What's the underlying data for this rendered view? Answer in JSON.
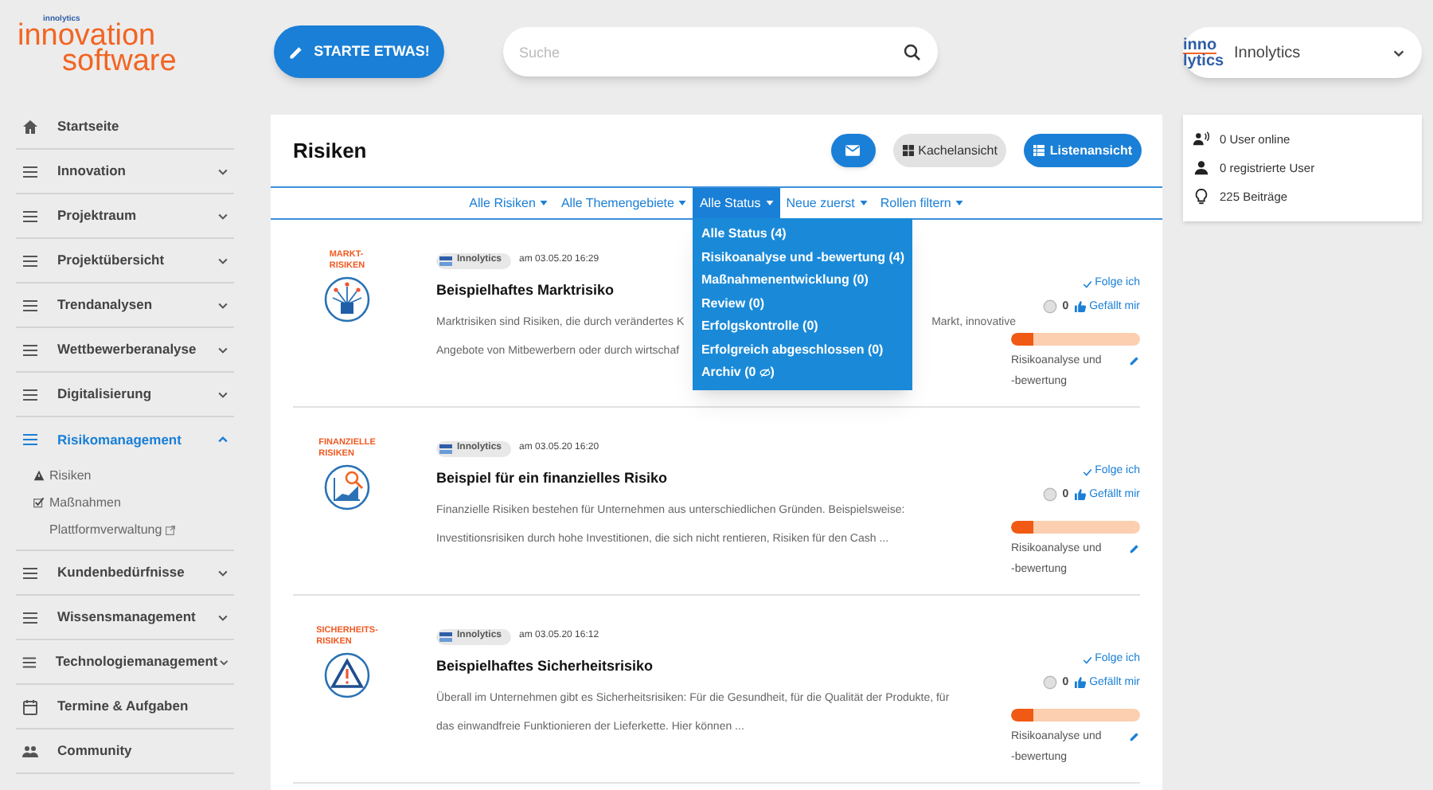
{
  "logo": {
    "brand": "innolytics",
    "line1": "innovation",
    "line2": "software"
  },
  "start_button": {
    "label": "STARTE ETWAS!"
  },
  "search": {
    "placeholder": "Suche"
  },
  "org_selector": {
    "logo_lines": [
      "inno",
      "lytics"
    ],
    "label": "Innolytics"
  },
  "sidebar": {
    "items": [
      {
        "label": "Startseite",
        "kind": "home",
        "selected": false
      },
      {
        "label": "Innovation",
        "kind": "menu",
        "selected": false,
        "expanded": false
      },
      {
        "label": "Projektraum",
        "kind": "menu",
        "selected": false,
        "expanded": false
      },
      {
        "label": "Projektübersicht",
        "kind": "menu",
        "selected": false,
        "expanded": false
      },
      {
        "label": "Trendanalysen",
        "kind": "menu",
        "selected": false,
        "expanded": false
      },
      {
        "label": "Wettbewerberanalyse",
        "kind": "menu",
        "selected": false,
        "expanded": false
      },
      {
        "label": "Digitalisierung",
        "kind": "menu",
        "selected": false,
        "expanded": false
      },
      {
        "label": "Risikomanagement",
        "kind": "menu",
        "selected": true,
        "expanded": true,
        "children": [
          {
            "label": "Risiken",
            "kind": "warning"
          },
          {
            "label": "Maßnahmen",
            "kind": "check"
          },
          {
            "label": "Plattformverwaltung",
            "kind": "external"
          }
        ]
      },
      {
        "label": "Kundenbedürfnisse",
        "kind": "menu",
        "selected": false,
        "expanded": false
      },
      {
        "label": "Wissensmanagement",
        "kind": "menu",
        "selected": false,
        "expanded": false
      },
      {
        "label": "Technologiemanagement",
        "kind": "menu",
        "selected": false,
        "expanded": false
      },
      {
        "label": "Termine & Aufgaben",
        "kind": "calendar",
        "selected": false
      },
      {
        "label": "Community",
        "kind": "community",
        "selected": false
      }
    ]
  },
  "main": {
    "title": "Risiken",
    "view_buttons": [
      {
        "kind": "mail",
        "selected": false
      },
      {
        "kind": "tiles",
        "label": "Kachelansicht",
        "selected": false
      },
      {
        "kind": "list",
        "label": "Listenansicht",
        "selected": true
      }
    ],
    "filters": [
      {
        "label": "Alle Risiken",
        "selected": false
      },
      {
        "label": "Alle Themengebiete",
        "selected": false
      },
      {
        "label": "Alle Status",
        "selected": true,
        "expanded": true,
        "options": [
          {
            "label": "Alle Status (4)"
          },
          {
            "label": "Risikoanalyse und -bewertung (4)"
          },
          {
            "label": "Maßnahmenentwicklung (0)"
          },
          {
            "label": "Review (0)"
          },
          {
            "label": "Erfolgskontrolle (0)"
          },
          {
            "label": "Erfolgreich abgeschlossen (0)"
          },
          {
            "label": "Archiv (0",
            "suffix": ")",
            "kind": "hidden"
          }
        ]
      },
      {
        "label": "Neue zuerst",
        "selected": false
      },
      {
        "label": "Rollen filtern",
        "selected": false
      }
    ],
    "posts": [
      {
        "label": [
          "MARKT-",
          "RISIKEN"
        ],
        "kind": "market",
        "author": "Innolytics",
        "date": "am 03.05.20 16:29",
        "title": "Beispielhaftes Marktrisiko",
        "excerpt": [
          [
            "Marktrisiken sind Risiken, die durch verändertes K",
            "Markt, innovative"
          ],
          [
            "Angebote von Mitbewerbern oder durch wirtschaf"
          ]
        ],
        "follow": "Folge ich",
        "likes": "0",
        "like": "Gefällt mir",
        "level": 0.17,
        "status": "Risikoanalyse und -bewertung"
      },
      {
        "label": [
          "FINANZIELLE",
          "RISIKEN"
        ],
        "kind": "finance",
        "author": "Innolytics",
        "date": "am 03.05.20 16:20",
        "title": "Beispiel für ein finanzielles Risiko",
        "excerpt": [
          [
            "Finanzielle Risiken bestehen für Unternehmen aus unterschiedlichen Gründen. Beispielsweise:"
          ],
          [
            "Investitionsrisiken durch hohe Investitionen, die sich nicht rentieren, Risiken für den Cash ..."
          ]
        ],
        "follow": "Folge ich",
        "likes": "0",
        "like": "Gefällt mir",
        "level": 0.17,
        "status": "Risikoanalyse und -bewertung"
      },
      {
        "label": [
          "SICHERHEITS-",
          "RISIKEN"
        ],
        "kind": "safety",
        "author": "Innolytics",
        "date": "am 03.05.20 16:12",
        "title": "Beispielhaftes Sicherheitsrisiko",
        "excerpt": [
          [
            "Überall im Unternehmen gibt es Sicherheitsrisiken: Für die Gesundheit, für die Qualität der Produkte, für"
          ],
          [
            "das einwandfreie Funktionieren der Lieferkette. Hier können ..."
          ]
        ],
        "follow": "Folge ich",
        "likes": "0",
        "like": "Gefällt mir",
        "level": 0.17,
        "status": "Risikoanalyse und -bewertung"
      }
    ]
  },
  "stats": [
    {
      "kind": "online",
      "label": "0 User online"
    },
    {
      "kind": "user",
      "label": "0 registrierte User"
    },
    {
      "kind": "bulb",
      "label": "225 Beiträge"
    }
  ]
}
